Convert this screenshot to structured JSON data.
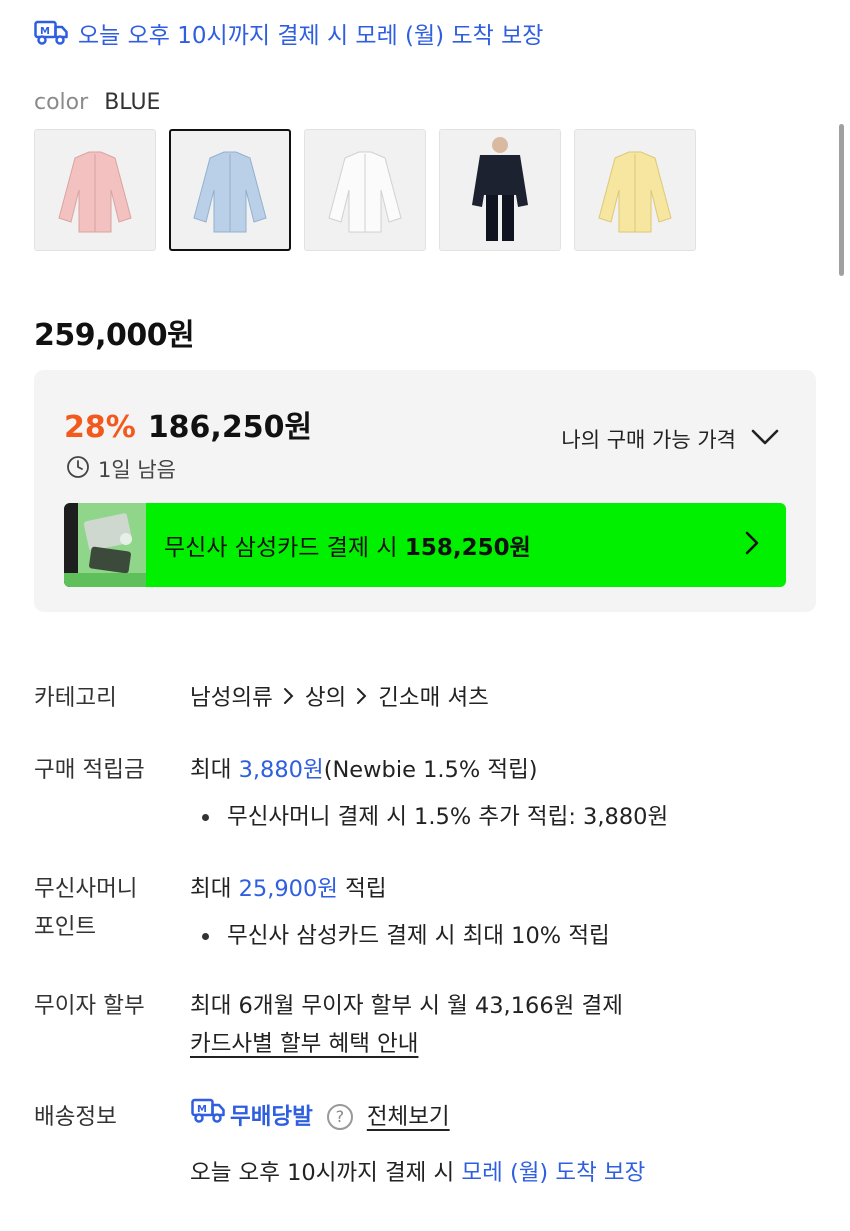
{
  "delivery_top": "오늘 오후 10시까지 결제 시 모레 (월) 도착 보장",
  "color": {
    "label": "color",
    "value": "BLUE"
  },
  "swatches": [
    {
      "name": "pink-shirt",
      "color": "#f3c2c0"
    },
    {
      "name": "blue-shirt",
      "color": "#b9d0e8"
    },
    {
      "name": "white-shirt",
      "color": "#f7f7f7"
    },
    {
      "name": "navy-shirt",
      "color": "#1c2230"
    },
    {
      "name": "yellow-shirt",
      "color": "#f6e6a0"
    }
  ],
  "original_price": "259,000원",
  "sale": {
    "rate": "28%",
    "price": "186,250원",
    "timer": "1일 남음",
    "my_price_label": "나의 구매 가능 가격"
  },
  "card_banner": {
    "text": "무신사 삼성카드 결제 시 ",
    "price": "158,250원",
    "bg_color": "#00f000"
  },
  "category": {
    "label": "카테고리",
    "path": [
      "남성의류",
      "상의",
      "긴소매 셔츠"
    ]
  },
  "points": {
    "label": "구매 적립금",
    "max_prefix": "최대 ",
    "max_value": "3,880원",
    "max_suffix": "(Newbie 1.5% 적립)",
    "bullet": "무신사머니 결제 시 1.5% 추가 적립: 3,880원"
  },
  "money_points": {
    "label_line1": "무신사머니",
    "label_line2": "포인트",
    "max_prefix": "최대 ",
    "max_value": "25,900원",
    "max_suffix": " 적립",
    "bullet": "무신사 삼성카드 결제 시 최대 10% 적립"
  },
  "installment": {
    "label": "무이자 할부",
    "text": "최대 6개월 무이자 할부 시 월 43,166원 결제",
    "link": "카드사별 할부 혜택 안내"
  },
  "shipping": {
    "label": "배송정보",
    "badge": "무배당발",
    "view_all": "전체보기",
    "note_prefix": "오늘 오후 10시까지 결제 시 ",
    "note_highlight": "모레 (월) 도착 보장"
  }
}
